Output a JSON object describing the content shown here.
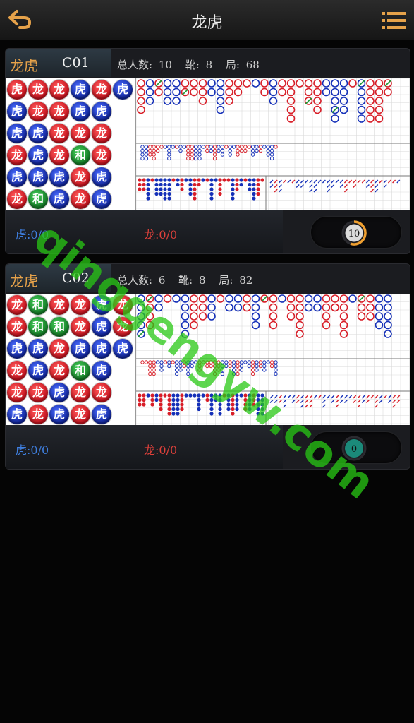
{
  "header": {
    "title": "龙虎"
  },
  "colors": {
    "red": "#d81e28",
    "blue": "#1530b8",
    "green": "#1f9a36",
    "accent": "#e6a24a"
  },
  "tables": [
    {
      "name": "龙虎",
      "code": "C01",
      "players_label": "总人数:",
      "players": "10",
      "shoe_label": "靴:",
      "shoe": "8",
      "round_label": "局:",
      "round": "68",
      "beads": [
        [
          "虎",
          "虎",
          "虎",
          "龙",
          "虎",
          "龙"
        ],
        [
          "龙",
          "龙",
          "虎",
          "虎",
          "虎",
          "和"
        ],
        [
          "龙",
          "龙",
          "龙",
          "龙",
          "虎",
          "虎"
        ],
        [
          "虎",
          "虎",
          "龙",
          "和",
          "龙",
          "龙"
        ],
        [
          "龙",
          "虎",
          "龙",
          "龙",
          "虎",
          "虎"
        ],
        [
          "虎",
          "",
          "",
          "",
          "",
          ""
        ]
      ],
      "bead_colors": [
        [
          "red",
          "blue",
          "blue",
          "red",
          "blue",
          "red"
        ],
        [
          "red",
          "red",
          "blue",
          "blue",
          "blue",
          "green"
        ],
        [
          "red",
          "red",
          "red",
          "red",
          "blue",
          "blue"
        ],
        [
          "blue",
          "blue",
          "red",
          "green",
          "red",
          "red"
        ],
        [
          "red",
          "blue",
          "red",
          "red",
          "blue",
          "blue"
        ],
        [
          "blue",
          "",
          "",
          "",
          "",
          ""
        ]
      ],
      "tiger_label": "虎:",
      "tiger_value": "0/0",
      "dragon_label": "龙:",
      "dragon_value": "0/0",
      "countdown": "10",
      "countdown_progress": 0.55
    },
    {
      "name": "龙虎",
      "code": "C02",
      "players_label": "总人数:",
      "players": "6",
      "shoe_label": "靴:",
      "shoe": "8",
      "round_label": "局:",
      "round": "82",
      "beads": [
        [
          "龙",
          "龙",
          "虎",
          "龙",
          "龙",
          "虎"
        ],
        [
          "和",
          "和",
          "虎",
          "虎",
          "龙",
          "龙"
        ],
        [
          "龙",
          "和",
          "龙",
          "龙",
          "虎",
          "虎"
        ],
        [
          "龙",
          "龙",
          "虎",
          "和",
          "龙",
          "龙"
        ],
        [
          "虎",
          "虎",
          "虎",
          "虎",
          "龙",
          "虎"
        ],
        [
          "龙",
          "龙",
          "虎",
          "",
          "",
          ""
        ]
      ],
      "bead_colors": [
        [
          "red",
          "red",
          "blue",
          "red",
          "red",
          "blue"
        ],
        [
          "green",
          "green",
          "blue",
          "blue",
          "red",
          "red"
        ],
        [
          "red",
          "green",
          "red",
          "red",
          "blue",
          "blue"
        ],
        [
          "red",
          "red",
          "blue",
          "green",
          "red",
          "red"
        ],
        [
          "blue",
          "blue",
          "blue",
          "blue",
          "red",
          "blue"
        ],
        [
          "red",
          "red",
          "blue",
          "",
          "",
          ""
        ]
      ],
      "tiger_label": "虎:",
      "tiger_value": "0/0",
      "dragon_label": "龙:",
      "dragon_value": "0/0",
      "countdown": "0",
      "countdown_progress": 0
    }
  ],
  "watermark": "qinggengyw.com"
}
